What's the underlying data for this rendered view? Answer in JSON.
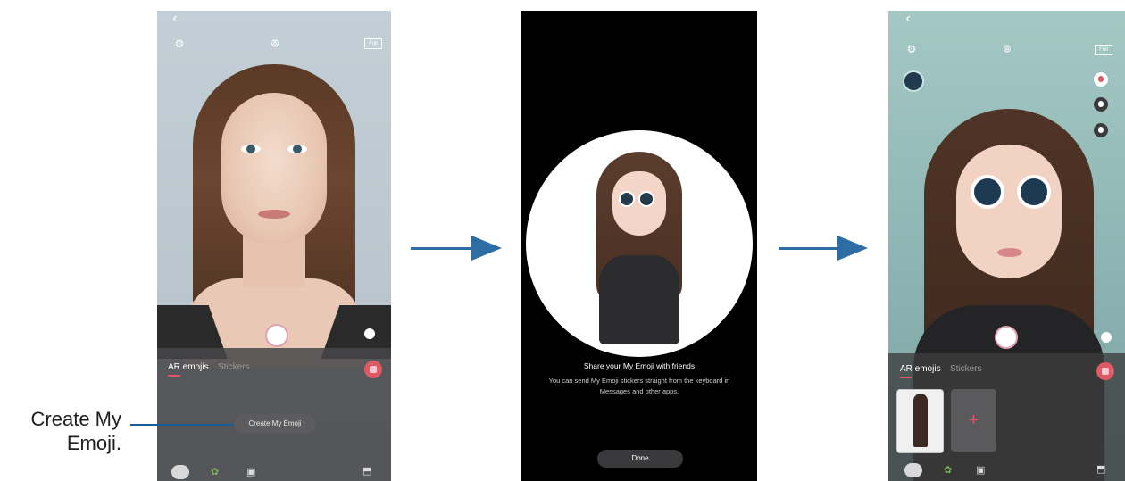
{
  "callout": {
    "line1": "Create My",
    "line2": "Emoji."
  },
  "screen1": {
    "top_icons": {
      "back": "‹",
      "settings": "⚙",
      "flash": "ꔮ",
      "ratio": "Full"
    },
    "tabs": [
      "AR emojis",
      "Stickers"
    ],
    "create_button": "Create My Emoji"
  },
  "screen2": {
    "share_title": "Share your My Emoji with friends",
    "share_body": "You can send My Emoji stickers straight from the keyboard in Messages and other apps.",
    "done_button": "Done"
  },
  "screen3": {
    "top_icons": {
      "back": "‹",
      "settings": "⚙",
      "flash": "ꔮ",
      "ratio": "Full"
    },
    "tabs": [
      "AR emojis",
      "Stickers"
    ],
    "add_symbol": "+"
  },
  "colors": {
    "accent": "#e0536a",
    "arrow": "#2d6da3",
    "callout": "#1a5e97"
  },
  "icons": [
    "back-icon",
    "settings-icon",
    "flash-off-icon",
    "aspect-ratio-icon",
    "shutter-button",
    "mask-icon",
    "camera-switch-icon",
    "gallery-icon",
    "sticker-icon",
    "store-icon",
    "avatar-icon"
  ]
}
